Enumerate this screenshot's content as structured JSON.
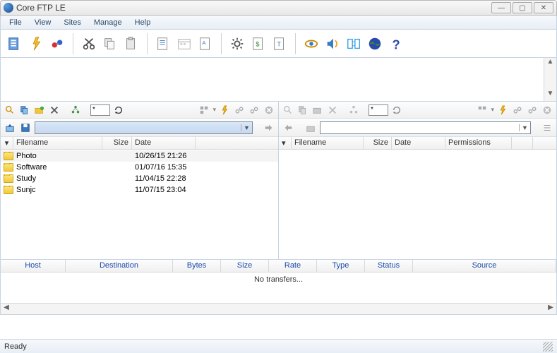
{
  "window": {
    "title": "Core FTP LE"
  },
  "menu": {
    "file": "File",
    "view": "View",
    "sites": "Sites",
    "manage": "Manage",
    "help": "Help"
  },
  "local": {
    "filter": "*",
    "path": "",
    "cols": {
      "filename": "Filename",
      "size": "Size",
      "date": "Date"
    },
    "rows": [
      {
        "name": "Photo",
        "size": "",
        "date": "10/26/15  21:26"
      },
      {
        "name": "Software",
        "size": "",
        "date": "01/07/16  15:35"
      },
      {
        "name": "Study",
        "size": "",
        "date": "11/04/15  22:28"
      },
      {
        "name": "Sunjc",
        "size": "",
        "date": "11/07/15  23:04"
      }
    ]
  },
  "remote": {
    "filter": "*",
    "path": "",
    "cols": {
      "filename": "Filename",
      "size": "Size",
      "date": "Date",
      "perm": "Permissions"
    }
  },
  "queue": {
    "cols": {
      "host": "Host",
      "dest": "Destination",
      "bytes": "Bytes",
      "size": "Size",
      "rate": "Rate",
      "type": "Type",
      "status": "Status",
      "source": "Source"
    },
    "empty": "No transfers..."
  },
  "status": {
    "ready": "Ready"
  }
}
